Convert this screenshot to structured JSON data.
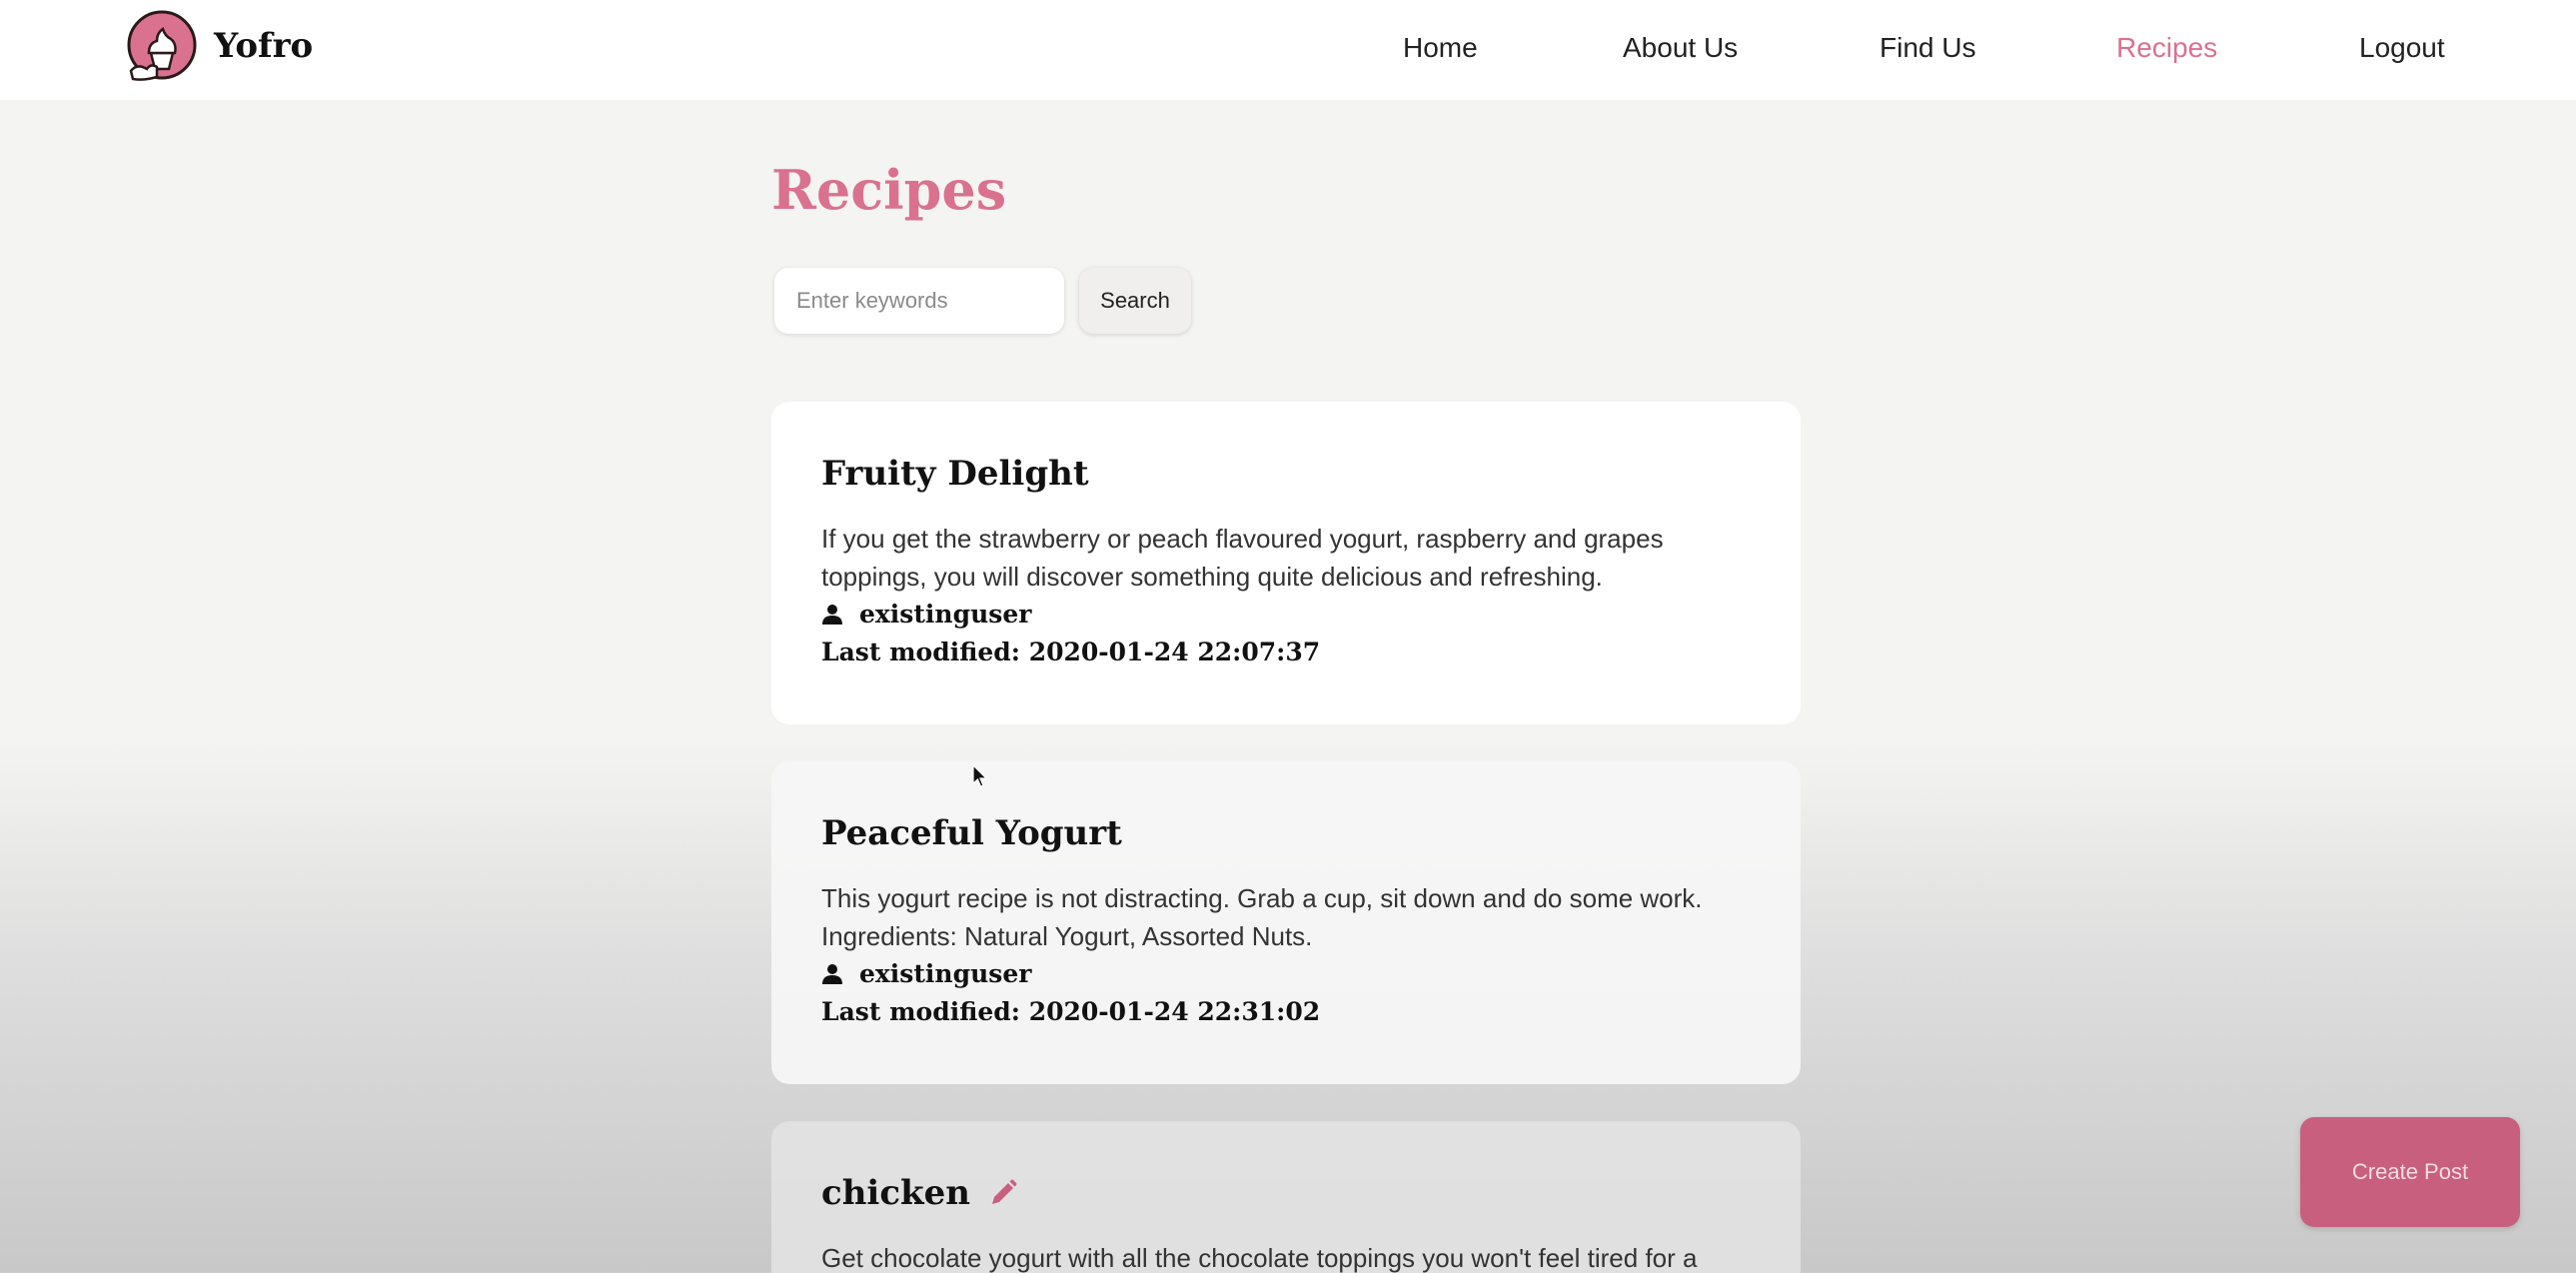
{
  "header": {
    "brand": "Yofro",
    "nav": [
      {
        "label": "Home",
        "active": false
      },
      {
        "label": "About Us",
        "active": false
      },
      {
        "label": "Find Us",
        "active": false
      },
      {
        "label": "Recipes",
        "active": true
      },
      {
        "label": "Logout",
        "active": false
      }
    ]
  },
  "main": {
    "title": "Recipes",
    "search": {
      "placeholder": "Enter keywords",
      "value": "",
      "button_label": "Search"
    },
    "recipes": [
      {
        "title": "Fruity Delight",
        "description_lines": [
          "If you get the strawberry or peach flavoured yogurt, raspberry and grapes",
          "toppings, you will discover something quite delicious and refreshing."
        ],
        "author": "existinguser",
        "modified": "Last modified: 2020-01-24 22:07:37"
      },
      {
        "title": "Peaceful Yogurt",
        "description_lines": [
          "This yogurt recipe is not distracting. Grab a cup, sit down and do some work.",
          "Ingredients: Natural Yogurt, Assorted Nuts."
        ],
        "author": "existinguser",
        "modified": "Last modified: 2020-01-24 22:31:02"
      },
      {
        "title": "chicken",
        "description_lines": [
          "Get chocolate yogurt with all the chocolate toppings you won't feel tired for a"
        ],
        "editable": true
      }
    ]
  },
  "actions": {
    "create_post_label": "Create Post"
  },
  "colors": {
    "accent": "#d9718f",
    "create_post_bg": "#c95f7f",
    "card_bg": "#ffffff",
    "page_bg": "#f4f4f2"
  },
  "icons": {
    "logo": "frozen-yogurt-logo-icon",
    "author": "user-icon",
    "edit": "pencil-icon",
    "cursor": "mouse-pointer-icon"
  }
}
